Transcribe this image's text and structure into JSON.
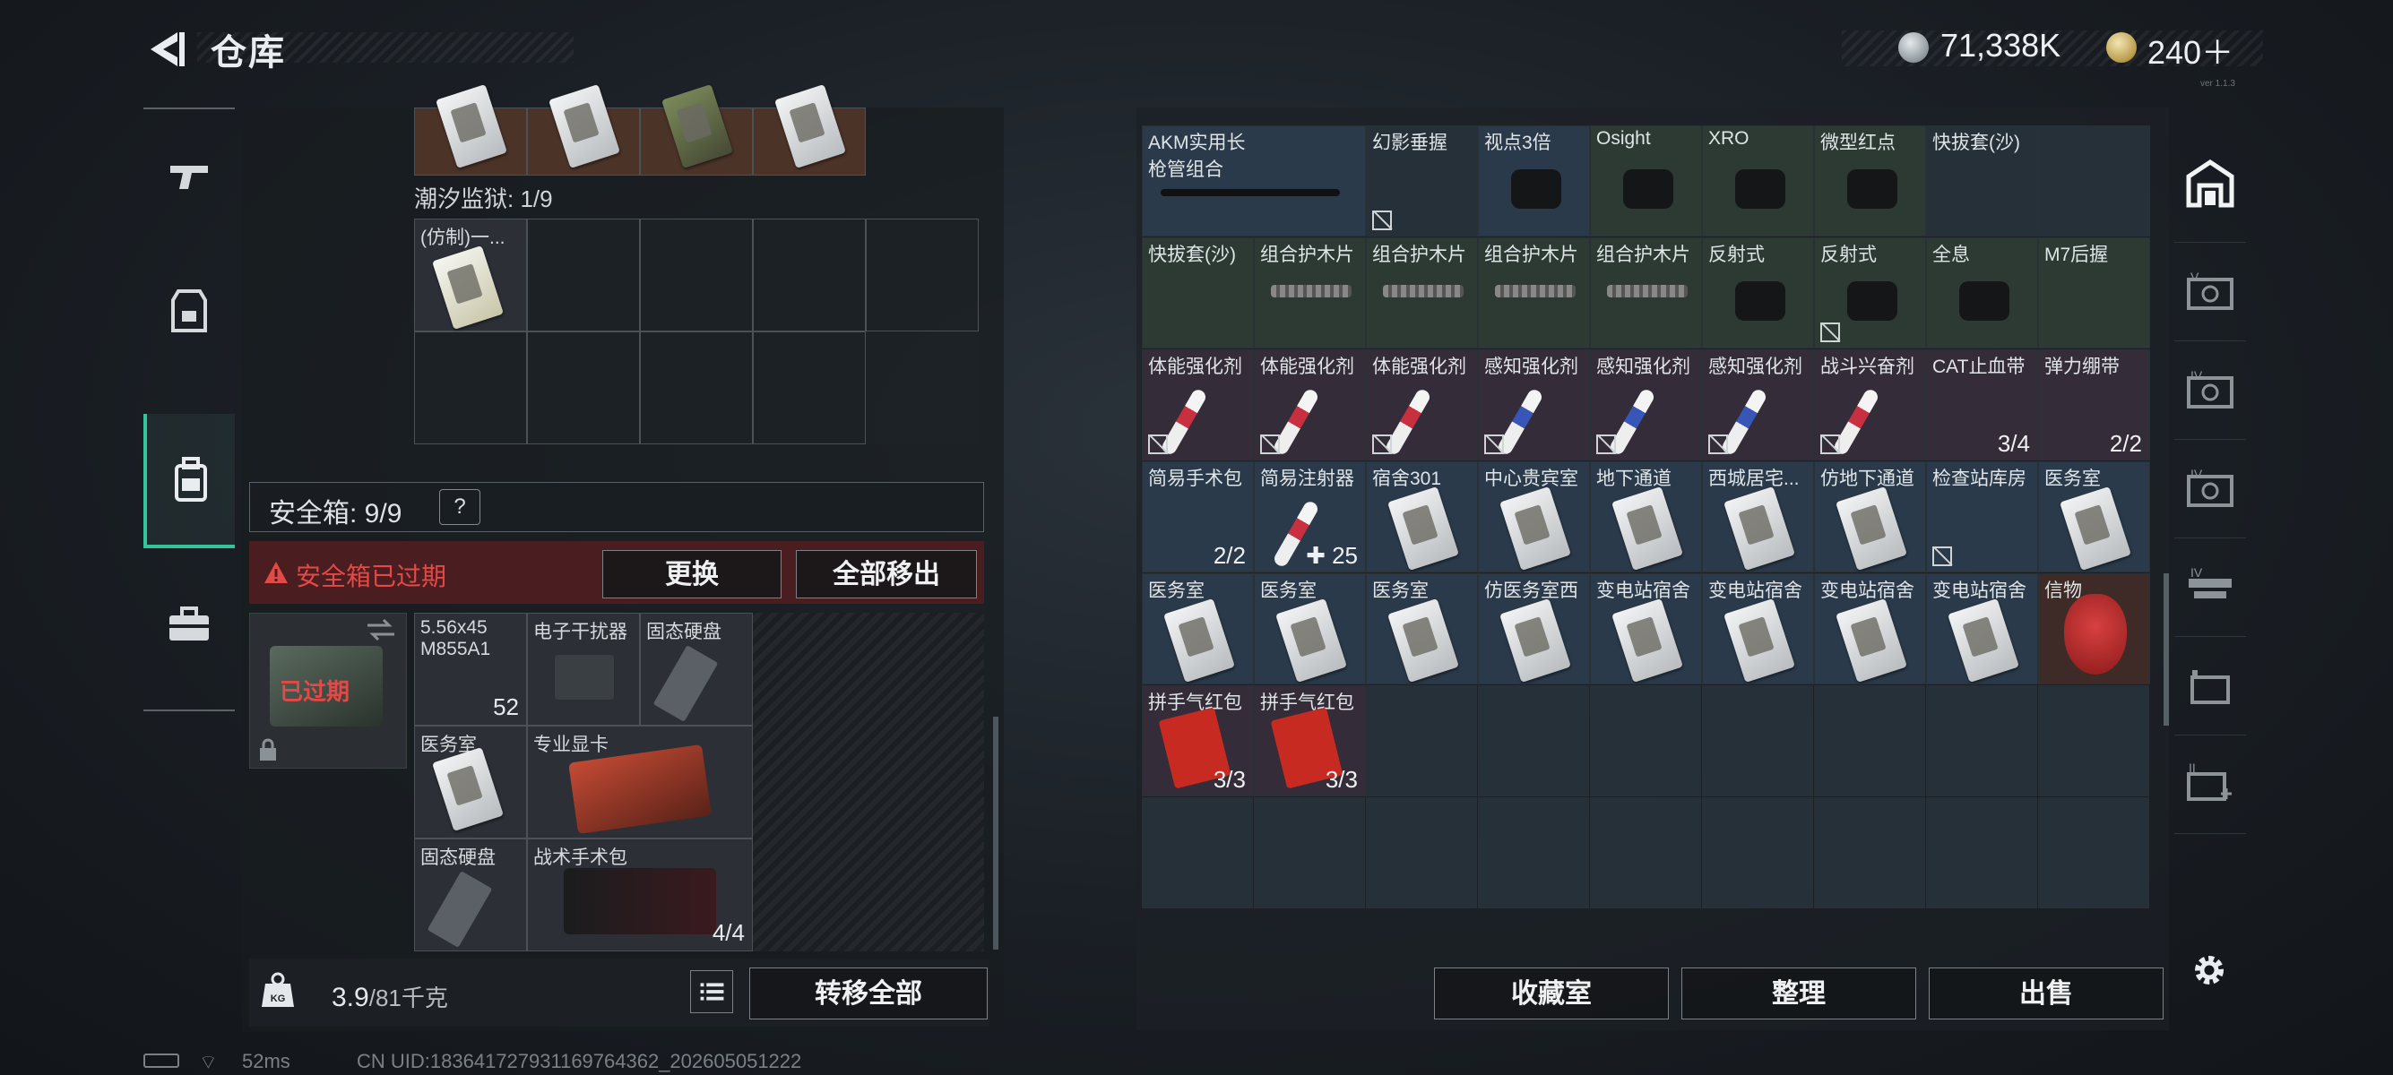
{
  "header": {
    "title": "仓库",
    "money": "71,338K",
    "gems": "240＋",
    "version": "ver 1.1.3"
  },
  "left": {
    "prison_label": "潮汐监狱: 1/9",
    "prison_item": "(仿制)一...",
    "safe_box_label": "安全箱: 9/9",
    "safe_help": "?",
    "expired_text": "安全箱已过期",
    "btn_replace": "更换",
    "btn_move_all": "全部移出",
    "case_expired": "已过期",
    "safe_items": [
      {
        "label": "5.56x45 M855A1",
        "count": "52"
      },
      {
        "label": "电子干扰器",
        "count": ""
      },
      {
        "label": "固态硬盘",
        "count": ""
      },
      {
        "label": "医务室",
        "count": ""
      },
      {
        "label": "专业显卡",
        "count": ""
      },
      {
        "label": "固态硬盘",
        "count": ""
      },
      {
        "label": "战术手术包",
        "count": "4/4"
      }
    ],
    "weight_value": "3.9",
    "weight_unit": "/81千克",
    "btn_transfer": "转移全部"
  },
  "right": {
    "rows": [
      [
        {
          "l": "AKM实用长枪管组合",
          "c": "",
          "t": "b",
          "x": "rail",
          "w": 2
        },
        {
          "l": "幻影垂握",
          "c": "",
          "t": "e",
          "x": "",
          "ni": true
        },
        {
          "l": "视点3倍",
          "c": "",
          "t": "b",
          "x": "scope"
        },
        {
          "l": "Osight",
          "c": "",
          "t": "g",
          "x": "scope"
        },
        {
          "l": "XRO",
          "c": "",
          "t": "g",
          "x": "scope"
        },
        {
          "l": "微型红点",
          "c": "",
          "t": "g",
          "x": "scope"
        },
        {
          "l": "快拔套(沙)",
          "c": "",
          "t": "e",
          "x": ""
        },
        {
          "l": "",
          "c": "",
          "t": "e",
          "x": ""
        }
      ],
      [
        {
          "l": "快拔套(沙)",
          "c": "",
          "t": "g",
          "x": ""
        },
        {
          "l": "组合护木片",
          "c": "",
          "t": "g",
          "x": "rail"
        },
        {
          "l": "组合护木片",
          "c": "",
          "t": "g",
          "x": "rail"
        },
        {
          "l": "组合护木片",
          "c": "",
          "t": "g",
          "x": "rail"
        },
        {
          "l": "组合护木片",
          "c": "",
          "t": "g",
          "x": "rail"
        },
        {
          "l": "反射式",
          "c": "",
          "t": "g",
          "x": "scope"
        },
        {
          "l": "反射式",
          "c": "",
          "t": "g",
          "x": "scope",
          "ni": true
        },
        {
          "l": "全息",
          "c": "",
          "t": "g",
          "x": "scope"
        },
        {
          "l": "M7后握",
          "c": "",
          "t": "g",
          "x": ""
        }
      ],
      [
        {
          "l": "体能强化剂",
          "c": "",
          "t": "p",
          "x": "red-vial",
          "ni": true
        },
        {
          "l": "体能强化剂",
          "c": "",
          "t": "p",
          "x": "red-vial",
          "ni": true
        },
        {
          "l": "体能强化剂",
          "c": "",
          "t": "p",
          "x": "red-vial",
          "ni": true
        },
        {
          "l": "感知强化剂",
          "c": "",
          "t": "p",
          "x": "blue-vial",
          "ni": true
        },
        {
          "l": "感知强化剂",
          "c": "",
          "t": "p",
          "x": "blue-vial",
          "ni": true
        },
        {
          "l": "感知强化剂",
          "c": "",
          "t": "p",
          "x": "blue-vial",
          "ni": true
        },
        {
          "l": "战斗兴奋剂",
          "c": "",
          "t": "p",
          "x": "red-vial",
          "ni": true
        },
        {
          "l": "CAT止血带",
          "c": "3/4",
          "t": "p",
          "x": ""
        },
        {
          "l": "弹力绷带",
          "c": "2/2",
          "t": "p",
          "x": ""
        }
      ],
      [
        {
          "l": "简易手术包",
          "c": "2/2",
          "t": "b",
          "x": ""
        },
        {
          "l": "简易注射器",
          "c": "✚ 25",
          "t": "b",
          "x": "red-vial"
        },
        {
          "l": "宿舍301",
          "c": "",
          "t": "b",
          "x": "card"
        },
        {
          "l": "中心贵宾室",
          "c": "",
          "t": "b",
          "x": "card"
        },
        {
          "l": "地下通道",
          "c": "",
          "t": "b",
          "x": "card"
        },
        {
          "l": "西城居宅...",
          "c": "",
          "t": "b",
          "x": "card"
        },
        {
          "l": "仿地下通道",
          "c": "",
          "t": "b",
          "x": "card"
        },
        {
          "l": "检查站库房",
          "c": "",
          "t": "b",
          "x": "",
          "ni": true
        },
        {
          "l": "医务室",
          "c": "",
          "t": "b",
          "x": "card"
        }
      ],
      [
        {
          "l": "医务室",
          "c": "",
          "t": "b",
          "x": "card"
        },
        {
          "l": "医务室",
          "c": "",
          "t": "b",
          "x": "card"
        },
        {
          "l": "医务室",
          "c": "",
          "t": "b",
          "x": "card"
        },
        {
          "l": "仿医务室西",
          "c": "",
          "t": "b",
          "x": "card"
        },
        {
          "l": "变电站宿舍",
          "c": "",
          "t": "b",
          "x": "card"
        },
        {
          "l": "变电站宿舍",
          "c": "",
          "t": "b",
          "x": "card"
        },
        {
          "l": "变电站宿舍",
          "c": "",
          "t": "b",
          "x": "card"
        },
        {
          "l": "变电站宿舍",
          "c": "",
          "t": "b",
          "x": "card"
        },
        {
          "l": "信物",
          "c": "",
          "t": "r",
          "x": "mask"
        }
      ],
      [
        {
          "l": "拼手气红包",
          "c": "3/3",
          "t": "p",
          "x": "redpack"
        },
        {
          "l": "拼手气红包",
          "c": "3/3",
          "t": "p",
          "x": "redpack"
        }
      ]
    ],
    "btn_collect": "收藏室",
    "btn_sort": "整理",
    "btn_sell": "出售"
  },
  "status": {
    "ping": "52ms",
    "uid": "CN UID:18364172793116976436​2_202605051222"
  }
}
